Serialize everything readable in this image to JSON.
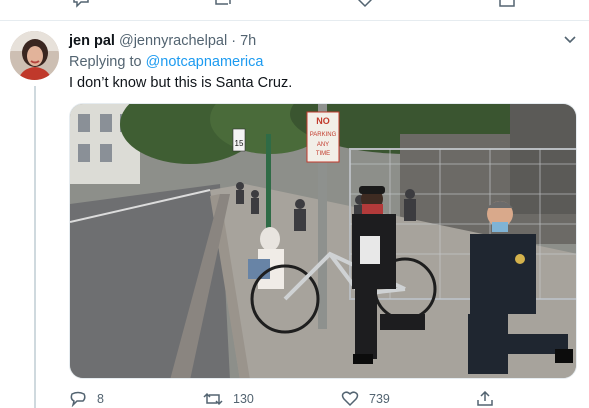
{
  "tweet": {
    "author_name": "jen pal",
    "author_handle": "@jennyrachelpal",
    "separator": "·",
    "timestamp": "7h",
    "reply_prefix": "Replying to",
    "reply_mention": "@notcapnamerica",
    "text": "I don’t know but this is Santa Cruz."
  },
  "photo": {
    "signs": {
      "no_parking_line1": "NO",
      "no_parking_line2": "PARKING",
      "no_parking_line3": "ANY",
      "no_parking_line4": "TIME",
      "speed_limit": "15"
    }
  },
  "actions": {
    "reply_count": "8",
    "retweet_count": "130",
    "like_count": "739"
  },
  "colors": {
    "accent": "#1d9bf0",
    "muted_text": "#536471",
    "primary_text": "#0f1419",
    "divider": "#e6ecf0"
  },
  "icons": [
    "reply-icon",
    "retweet-icon",
    "like-icon",
    "share-icon",
    "chevron-down-icon"
  ]
}
